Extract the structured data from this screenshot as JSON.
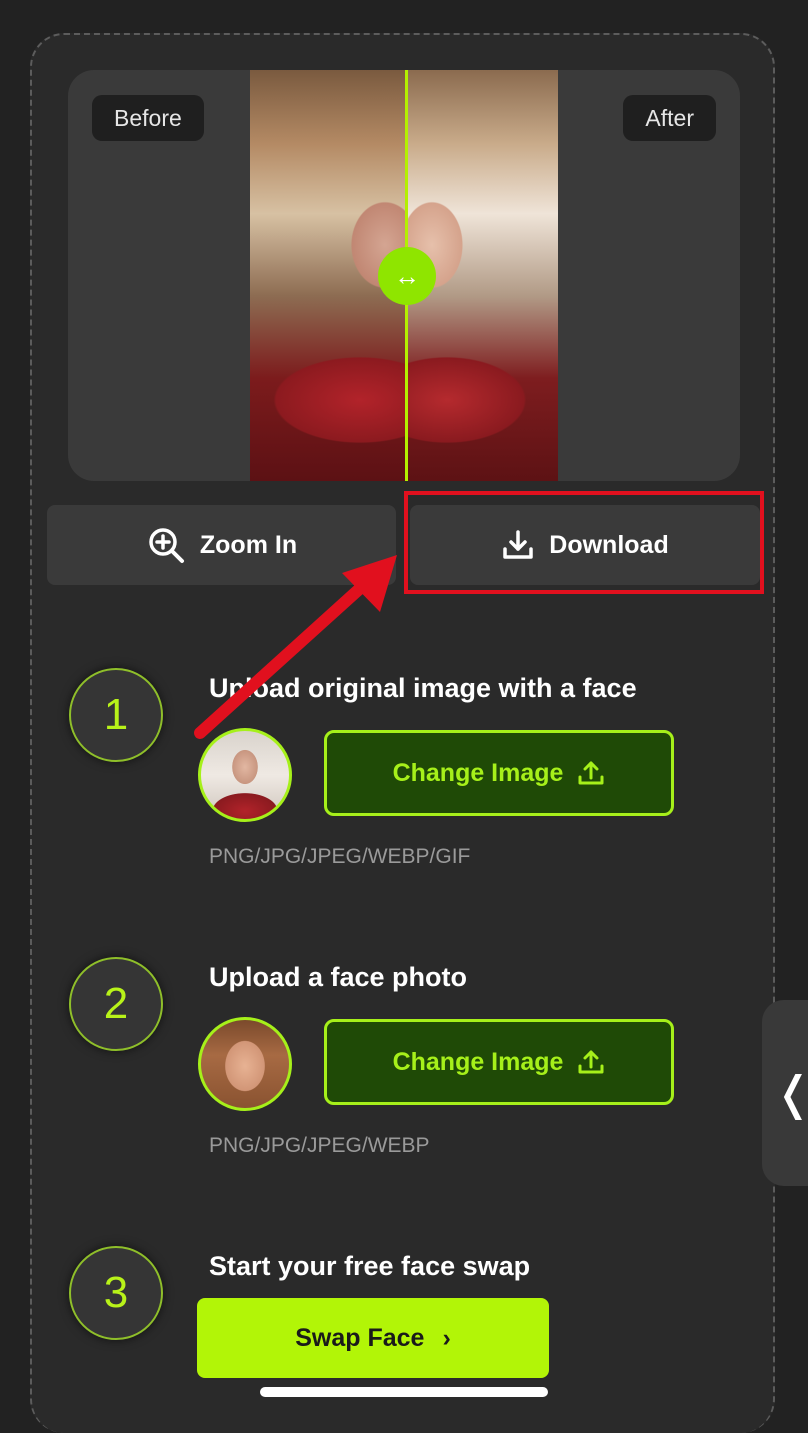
{
  "preview": {
    "before_label": "Before",
    "after_label": "After",
    "handle_glyph": "↔"
  },
  "actions": {
    "zoom_label": "Zoom In",
    "zoom_icon": "zoom-in-icon",
    "download_label": "Download",
    "download_icon": "download-icon"
  },
  "steps": [
    {
      "number": "1",
      "title": "Upload original image with a face",
      "button_label": "Change Image",
      "formats": "PNG/JPG/JPEG/WEBP/GIF"
    },
    {
      "number": "2",
      "title": "Upload a face photo",
      "button_label": "Change Image",
      "formats": "PNG/JPG/JPEG/WEBP"
    },
    {
      "number": "3",
      "title": "Start your free face swap",
      "button_label": "Swap Face",
      "button_glyph": "›"
    }
  ],
  "side_tab": {
    "glyph": "❬"
  },
  "colors": {
    "accent": "#a6f01a",
    "highlight": "#e1101e",
    "background": "#222222"
  }
}
